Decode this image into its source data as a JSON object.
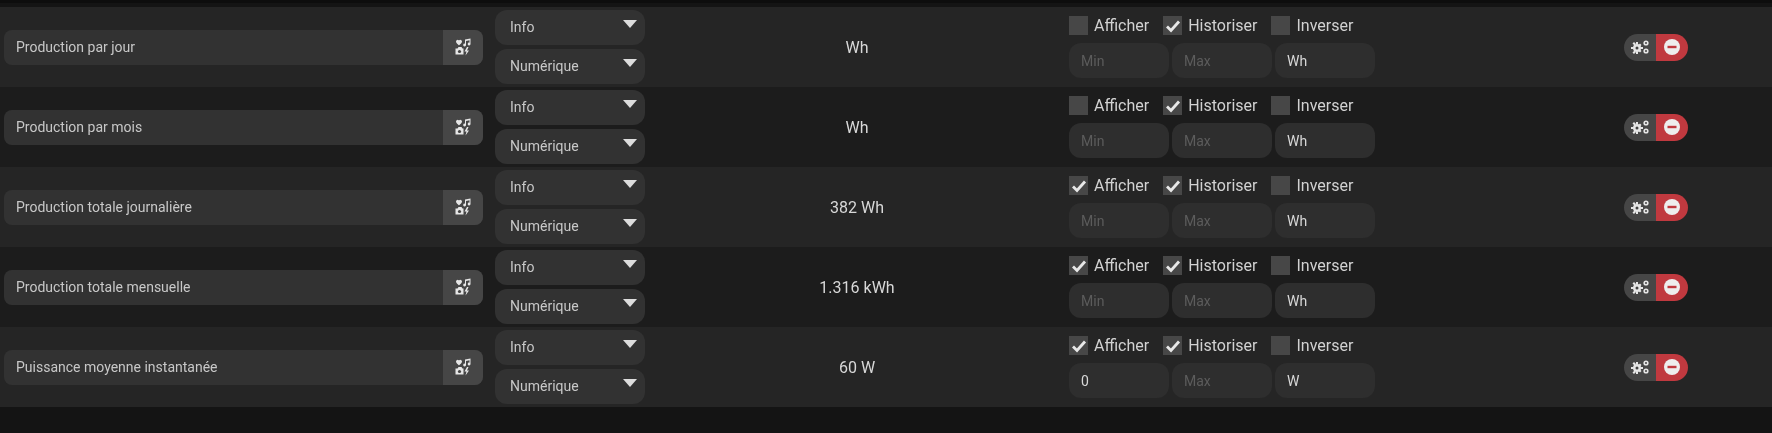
{
  "rows": [
    {
      "name": "Production par jour",
      "type": "Info",
      "subtype": "Numérique",
      "value": "Wh",
      "options": [
        {
          "label": "Afficher",
          "checked": false
        },
        {
          "label": "Historiser",
          "checked": true
        },
        {
          "label": "Inverser",
          "checked": false
        }
      ],
      "min": {
        "placeholder": "Min"
      },
      "max": {
        "placeholder": "Max"
      },
      "unit": {
        "value": "Wh"
      }
    },
    {
      "name": "Production par mois",
      "type": "Info",
      "subtype": "Numérique",
      "value": "Wh",
      "options": [
        {
          "label": "Afficher",
          "checked": false
        },
        {
          "label": "Historiser",
          "checked": true
        },
        {
          "label": "Inverser",
          "checked": false
        }
      ],
      "min": {
        "placeholder": "Min"
      },
      "max": {
        "placeholder": "Max"
      },
      "unit": {
        "value": "Wh"
      }
    },
    {
      "name": "Production totale journalière",
      "type": "Info",
      "subtype": "Numérique",
      "value": "382 Wh",
      "options": [
        {
          "label": "Afficher",
          "checked": true
        },
        {
          "label": "Historiser",
          "checked": true
        },
        {
          "label": "Inverser",
          "checked": false
        }
      ],
      "min": {
        "placeholder": "Min"
      },
      "max": {
        "placeholder": "Max"
      },
      "unit": {
        "value": "Wh"
      }
    },
    {
      "name": "Production totale mensuelle",
      "type": "Info",
      "subtype": "Numérique",
      "value": "1.316 kWh",
      "options": [
        {
          "label": "Afficher",
          "checked": true
        },
        {
          "label": "Historiser",
          "checked": true
        },
        {
          "label": "Inverser",
          "checked": false
        }
      ],
      "min": {
        "placeholder": "Min"
      },
      "max": {
        "placeholder": "Max"
      },
      "unit": {
        "value": "Wh"
      }
    },
    {
      "name": "Puissance moyenne instantanée",
      "type": "Info",
      "subtype": "Numérique",
      "value": "60 W",
      "options": [
        {
          "label": "Afficher",
          "checked": true
        },
        {
          "label": "Historiser",
          "checked": true
        },
        {
          "label": "Inverser",
          "checked": false
        }
      ],
      "min": {
        "value": "0"
      },
      "max": {
        "placeholder": "Max"
      },
      "unit": {
        "value": "W"
      }
    }
  ]
}
